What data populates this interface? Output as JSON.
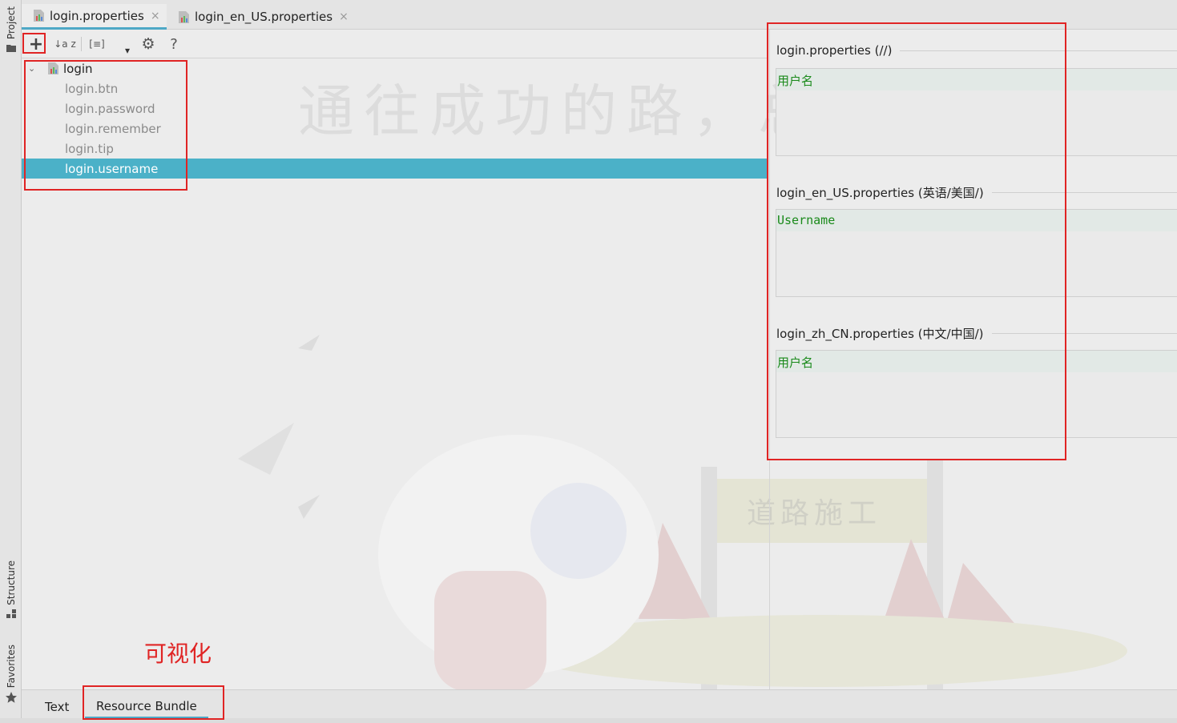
{
  "sidebar": {
    "project_label": "Project",
    "structure_label": "Structure",
    "favorites_label": "Favorites"
  },
  "tabs": [
    {
      "label": "login.properties",
      "close": "×"
    },
    {
      "label": "login_en_US.properties",
      "close": "×"
    }
  ],
  "toolbar": {
    "add": "+",
    "sort": "↓a z",
    "group": "[≡]",
    "dropdown": "▾",
    "settings": "⚙",
    "help": "?"
  },
  "tree": {
    "root": "login",
    "keys": [
      "login.btn",
      "login.password",
      "login.remember",
      "login.tip",
      "login.username"
    ],
    "selected": "login.username"
  },
  "watermark": {
    "banner": "通往成功的路，总是正在施",
    "sign": "道路施工"
  },
  "locales": [
    {
      "title": "login.properties (//)",
      "value": "用户名"
    },
    {
      "title": "login_en_US.properties (英语/美国/)",
      "value": "Username"
    },
    {
      "title": "login_zh_CN.properties (中文/中国/)",
      "value": "用户名"
    }
  ],
  "bottom_tabs": [
    "Text",
    "Resource Bundle"
  ],
  "annotation": "可视化",
  "colors": {
    "selection": "#4bb1c8",
    "value_text": "#198a1a",
    "annotation_red": "#e02424",
    "tab_underline": "#4ea8c6"
  }
}
